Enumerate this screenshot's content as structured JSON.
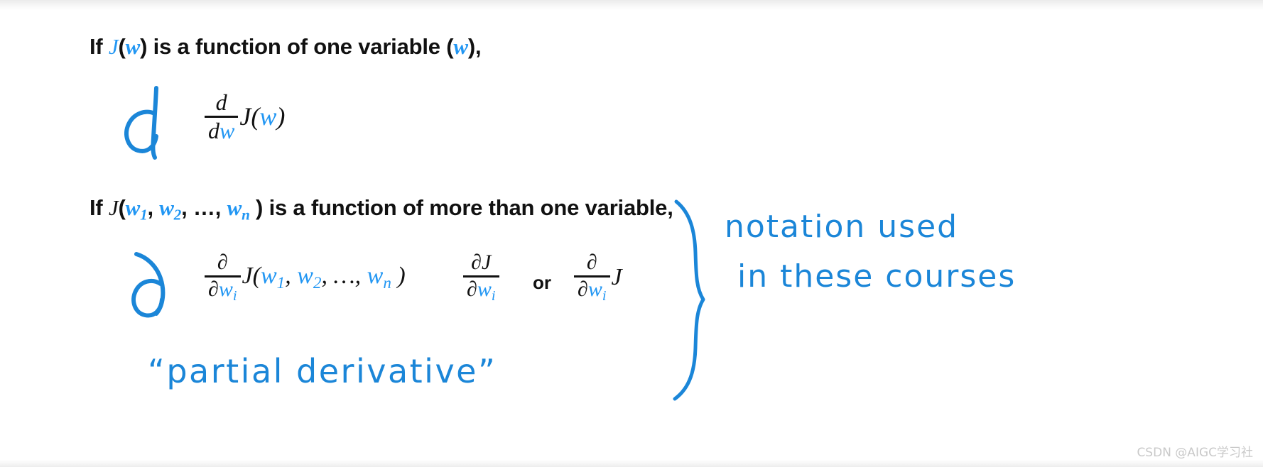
{
  "slide": {
    "background_color": "#ffffff",
    "text_color": "#111111",
    "accent_color": "#2196f3",
    "handwriting_color": "#1b86d8"
  },
  "line1": {
    "prefix": "If ",
    "func": "J",
    "open_paren": "(",
    "var": "w",
    "close_paren": ")",
    "middle": " is a function of one variable (",
    "var2": "w",
    "suffix": "),"
  },
  "line2": {
    "prefix": "If ",
    "func": "J",
    "open_paren": "(",
    "var1": "w",
    "sub1": "1",
    "comma1": ", ",
    "var2": "w",
    "sub2": "2",
    "comma2": ", ",
    "ellipsis": "…",
    "comma3": ", ",
    "var3": "w",
    "sub3": "n",
    "close_paren": " )",
    "suffix": " is a function of more than one variable,"
  },
  "formula_ddw": {
    "numerator": "d",
    "denominator_d": "d",
    "denominator_w": "w",
    "tail_func": "J",
    "tail_open": "(",
    "tail_var": "w",
    "tail_close": ")"
  },
  "formula_partial_full": {
    "numerator": "∂",
    "denominator_d": "∂",
    "denominator_w": "w",
    "denominator_sub": "i",
    "tail_func": "J",
    "tail_open": "(",
    "tail_var1": "w",
    "tail_sub1": "1",
    "tail_comma1": ", ",
    "tail_var2": "w",
    "tail_sub2": "2",
    "tail_comma2": ", ",
    "tail_ellipsis": "…",
    "tail_comma3": ", ",
    "tail_var3": "w",
    "tail_sub3": "n",
    "tail_close": " )"
  },
  "formula_partial_j": {
    "numerator_d": "∂",
    "numerator_j": "J",
    "denominator_d": "∂",
    "denominator_w": "w",
    "denominator_sub": "i"
  },
  "or_label": "or",
  "formula_partial_short": {
    "numerator": "∂",
    "denominator_d": "∂",
    "denominator_w": "w",
    "denominator_sub": "i",
    "tail_func": "J"
  },
  "handwriting": {
    "symbol_d": "d",
    "symbol_partial": "∂",
    "partial_derivative_label": "“partial derivative”",
    "note_line_1": "notation  used",
    "note_line_2": "in these  courses",
    "brace": "curly-brace"
  },
  "watermark": "CSDN @AIGC学习社"
}
